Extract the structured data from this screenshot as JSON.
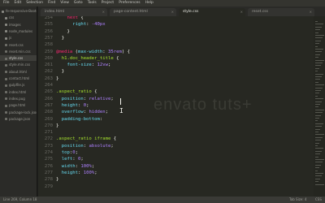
{
  "menubar": [
    "File",
    "Edit",
    "Selection",
    "Find",
    "View",
    "Goto",
    "Tools",
    "Project",
    "Preferences",
    "Help"
  ],
  "sidebar": {
    "items": [
      {
        "label": "fe-responsive-Bootstrap",
        "type": "folder"
      },
      {
        "label": "css",
        "type": "folder"
      },
      {
        "label": "images",
        "type": "folder"
      },
      {
        "label": "node_modules",
        "type": "folder"
      },
      {
        "label": "js",
        "type": "folder"
      },
      {
        "label": "reset.css",
        "type": "file"
      },
      {
        "label": "reset.min.css",
        "type": "file"
      },
      {
        "label": "style.css",
        "type": "file",
        "selected": true
      },
      {
        "label": "style.min.css",
        "type": "file"
      },
      {
        "label": "about.html",
        "type": "file"
      },
      {
        "label": "contact.html",
        "type": "file"
      },
      {
        "label": "gulpfile.js",
        "type": "file"
      },
      {
        "label": "index.html",
        "type": "file"
      },
      {
        "label": "index.pug",
        "type": "file"
      },
      {
        "label": "page.html",
        "type": "file"
      },
      {
        "label": "package-lock.json",
        "type": "file"
      },
      {
        "label": "package.json",
        "type": "file"
      }
    ]
  },
  "tabs": [
    {
      "label": "index.html",
      "active": false
    },
    {
      "label": "page-content.html",
      "active": false
    },
    {
      "label": "style.css",
      "active": true
    },
    {
      "label": "reset.css",
      "active": false
    }
  ],
  "editor": {
    "lines": [
      {
        "n": "254",
        "segs": [
          [
            "    ",
            "pl"
          ],
          [
            "next",
            "kw"
          ],
          [
            " {",
            "pl"
          ]
        ]
      },
      {
        "n": "255",
        "segs": [
          [
            "      ",
            "pl"
          ],
          [
            "right",
            "prop"
          ],
          [
            ": ",
            "pl"
          ],
          [
            "-40px",
            "val"
          ]
        ]
      },
      {
        "n": "256",
        "segs": [
          [
            "    }",
            "pl"
          ]
        ]
      },
      {
        "n": "257",
        "segs": [
          [
            "  }",
            "pl"
          ]
        ]
      },
      {
        "n": "258",
        "segs": [
          [
            "",
            "pl"
          ]
        ]
      },
      {
        "n": "259",
        "segs": [
          [
            "@media",
            "kw"
          ],
          [
            " (",
            "pl"
          ],
          [
            "max-width",
            "prop"
          ],
          [
            ": ",
            "pl"
          ],
          [
            "35rem",
            "val"
          ],
          [
            ") {",
            "pl"
          ]
        ]
      },
      {
        "n": "260",
        "segs": [
          [
            "  ",
            "pl"
          ],
          [
            "h1.doc_header_title",
            "sel-k"
          ],
          [
            " {",
            "pl"
          ]
        ]
      },
      {
        "n": "261",
        "segs": [
          [
            "    ",
            "pl"
          ],
          [
            "font-size",
            "prop"
          ],
          [
            ": ",
            "pl"
          ],
          [
            "12vw",
            "val"
          ],
          [
            ";",
            "pl"
          ]
        ]
      },
      {
        "n": "262",
        "segs": [
          [
            "  }",
            "pl"
          ]
        ]
      },
      {
        "n": "263",
        "segs": [
          [
            "}",
            "pl"
          ]
        ]
      },
      {
        "n": "264",
        "segs": [
          [
            "",
            "pl"
          ]
        ]
      },
      {
        "n": "265",
        "segs": [
          [
            ".aspect_ratio",
            "sel-k"
          ],
          [
            " {",
            "pl"
          ]
        ]
      },
      {
        "n": "266",
        "segs": [
          [
            "  ",
            "pl"
          ],
          [
            "position",
            "prop"
          ],
          [
            ": ",
            "pl"
          ],
          [
            "relative",
            "val"
          ],
          [
            ";",
            "pl"
          ]
        ]
      },
      {
        "n": "267",
        "segs": [
          [
            "  ",
            "pl"
          ],
          [
            "height",
            "prop"
          ],
          [
            ": ",
            "pl"
          ],
          [
            "0",
            "val"
          ],
          [
            ";",
            "pl"
          ]
        ]
      },
      {
        "n": "268",
        "segs": [
          [
            "  ",
            "pl"
          ],
          [
            "overflow",
            "prop"
          ],
          [
            ": ",
            "pl"
          ],
          [
            "hidden",
            "val"
          ],
          [
            ";",
            "pl"
          ]
        ]
      },
      {
        "n": "269",
        "segs": [
          [
            "  ",
            "pl"
          ],
          [
            "padding-bottom",
            "prop"
          ],
          [
            ": ",
            "pl"
          ]
        ]
      },
      {
        "n": "270",
        "segs": [
          [
            "}",
            "pl"
          ]
        ]
      },
      {
        "n": "271",
        "segs": [
          [
            "",
            "pl"
          ]
        ]
      },
      {
        "n": "272",
        "segs": [
          [
            ".aspect_ratio iframe",
            "sel-k"
          ],
          [
            " {",
            "pl"
          ]
        ]
      },
      {
        "n": "273",
        "segs": [
          [
            "  ",
            "pl"
          ],
          [
            "position",
            "prop"
          ],
          [
            ": ",
            "pl"
          ],
          [
            "absolute",
            "val"
          ],
          [
            ";",
            "pl"
          ]
        ]
      },
      {
        "n": "274",
        "segs": [
          [
            "  ",
            "pl"
          ],
          [
            "top",
            "prop"
          ],
          [
            ":",
            "pl"
          ],
          [
            "0",
            "val"
          ],
          [
            ";",
            "pl"
          ]
        ]
      },
      {
        "n": "275",
        "segs": [
          [
            "  ",
            "pl"
          ],
          [
            "left",
            "prop"
          ],
          [
            ": ",
            "pl"
          ],
          [
            "0",
            "val"
          ],
          [
            ";",
            "pl"
          ]
        ]
      },
      {
        "n": "276",
        "segs": [
          [
            "  ",
            "pl"
          ],
          [
            "width",
            "prop"
          ],
          [
            ": ",
            "pl"
          ],
          [
            "100%",
            "val"
          ],
          [
            ";",
            "pl"
          ]
        ]
      },
      {
        "n": "277",
        "segs": [
          [
            "  ",
            "pl"
          ],
          [
            "height",
            "prop"
          ],
          [
            ": ",
            "pl"
          ],
          [
            "100%",
            "val"
          ],
          [
            ";",
            "pl"
          ]
        ]
      },
      {
        "n": "278",
        "segs": [
          [
            "}",
            "pl"
          ]
        ]
      },
      {
        "n": "279",
        "segs": [
          [
            "",
            "pl"
          ]
        ]
      }
    ]
  },
  "watermark": "envato tuts+",
  "statusbar": {
    "left": "Line 269, Column 18",
    "right_tab": "Tab Size: 4",
    "right_syntax": "CSS"
  }
}
